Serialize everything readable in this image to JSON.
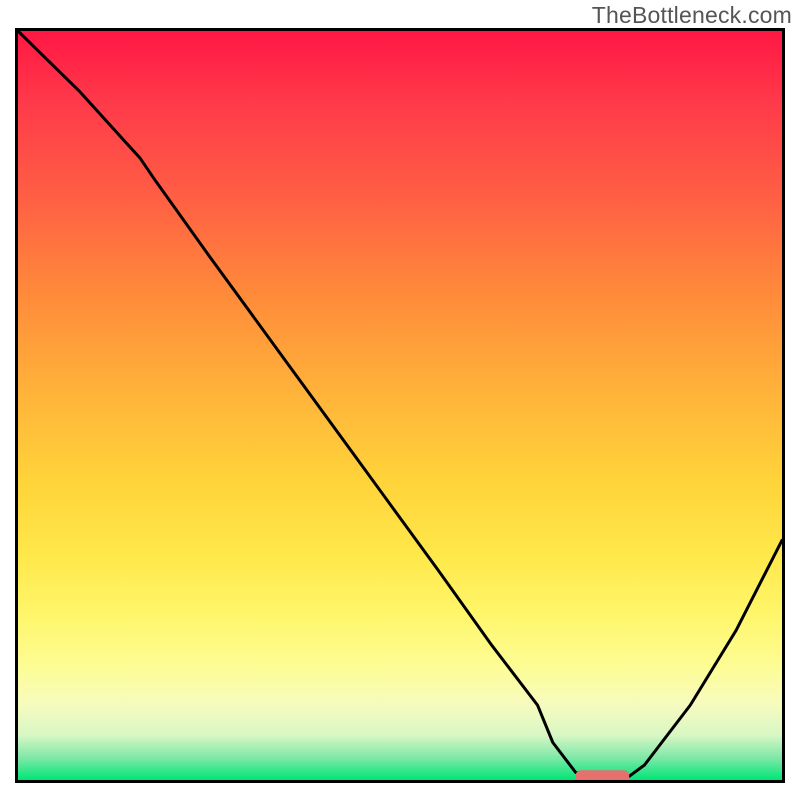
{
  "watermark": "TheBottleneck.com",
  "chart_data": {
    "type": "line",
    "title": "",
    "xlabel": "",
    "ylabel": "",
    "xlim": [
      0,
      100
    ],
    "ylim": [
      0,
      100
    ],
    "grid": false,
    "legend": false,
    "note": "Bottleneck curve over a mismatch-spectrum gradient background. The curve starts high (severe bottleneck) at low x, descends with a slight knee around x≈18, reaches an optimal (zero-bottleneck) plateau around x≈73–80, then rises again. Y-axis shown inverted in pixel space (top = high bottleneck, bottom = low). Values below are expressed as bottleneck percentage (0 = optimal green zone, 100 = worst red zone).",
    "series": [
      {
        "name": "bottleneck",
        "x": [
          0,
          8,
          16,
          18,
          25,
          35,
          45,
          55,
          62,
          68,
          70,
          73,
          76,
          80,
          82,
          88,
          94,
          100
        ],
        "values": [
          100,
          92,
          83,
          80,
          70,
          56,
          42,
          28,
          18,
          10,
          5,
          1,
          0.5,
          0.5,
          2,
          10,
          20,
          32
        ]
      }
    ],
    "minimum_marker": {
      "x_range": [
        73,
        80
      ],
      "y": 0.5,
      "color": "#e4716e"
    },
    "background_gradient": {
      "0": "#ff1744",
      "20": "#ff5e44",
      "40": "#ffb23a",
      "60": "#ffe84a",
      "80": "#fdfd96",
      "95": "#7fe8a8",
      "100": "#00e676"
    }
  }
}
